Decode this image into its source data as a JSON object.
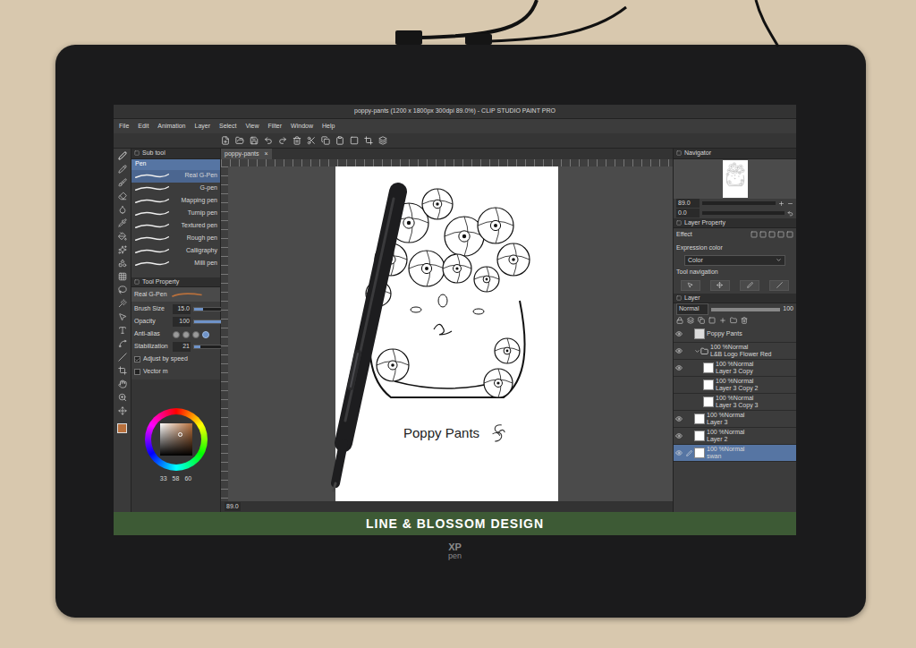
{
  "window": {
    "title": "poppy-pants (1200 x 1800px 300dpi 89.0%) - CLIP STUDIO PAINT PRO"
  },
  "menu": [
    "File",
    "Edit",
    "Animation",
    "Layer",
    "Select",
    "View",
    "Filter",
    "Window",
    "Help"
  ],
  "sub_tool": {
    "title": "Sub tool",
    "groups": [
      {
        "label": "Pen",
        "selected": true
      }
    ],
    "items": [
      {
        "label": "Real G-Pen",
        "selected": true
      },
      {
        "label": "G-pen",
        "selected": false
      },
      {
        "label": "Mapping pen",
        "selected": false
      },
      {
        "label": "Turnip pen",
        "selected": false
      },
      {
        "label": "Textured pen",
        "selected": false
      },
      {
        "label": "Rough pen",
        "selected": false
      },
      {
        "label": "Calligraphy",
        "selected": false
      },
      {
        "label": "Milli pen",
        "selected": false
      }
    ]
  },
  "tool_property": {
    "title": "Tool Property",
    "preset": "Real G-Pen",
    "rows": [
      {
        "kind": "slider",
        "label": "Brush Size",
        "value": "15.0",
        "level": 0.3
      },
      {
        "kind": "slider",
        "label": "Opacity",
        "value": "100",
        "level": 1
      },
      {
        "kind": "choice",
        "label": "Anti-alias",
        "options": [
          {
            "selected": false
          },
          {
            "selected": false
          },
          {
            "selected": false
          },
          {
            "selected": true
          }
        ]
      },
      {
        "kind": "slider",
        "label": "Stabilization",
        "value": "21",
        "level": 0.21
      },
      {
        "kind": "checkbox",
        "label": "Adjust by speed",
        "checked": true
      },
      {
        "kind": "checkbox",
        "label": "Vector m",
        "checked": false
      }
    ]
  },
  "color": {
    "main": "#b8703c",
    "values": [
      "33",
      "58",
      "60"
    ]
  },
  "document_tab": {
    "label": "poppy-pants",
    "close": "×"
  },
  "canvas": {
    "zoom": "89.0",
    "artwork_text": "Poppy Pants"
  },
  "navigator": {
    "title": "Navigator",
    "zoom": "89.0",
    "rotation": "0.0"
  },
  "layer_property": {
    "title": "Layer Property",
    "effect": "Effect",
    "expression_label": "Expression color",
    "expression_value": "Color",
    "tool_navigation": "Tool navigation"
  },
  "layers_panel": {
    "title": "Layer",
    "blend": "Normal",
    "opacity": "100",
    "layers": [
      {
        "name": "Poppy Pants",
        "kind": "text",
        "visible": true,
        "in_folder": false,
        "selected": false
      },
      {
        "name": "L&B Logo Flower Red",
        "mode": "100 %Normal",
        "kind": "folder",
        "expanded": true,
        "visible": true,
        "in_folder": false,
        "selected": false
      },
      {
        "name": "Layer 3 Copy",
        "mode": "100 %Normal",
        "kind": "raster",
        "visible": true,
        "in_folder": true,
        "selected": false
      },
      {
        "name": "Layer 3 Copy 2",
        "mode": "100 %Normal",
        "kind": "raster",
        "visible": false,
        "in_folder": true,
        "selected": false
      },
      {
        "name": "Layer 3 Copy 3",
        "mode": "100 %Normal",
        "kind": "raster",
        "visible": false,
        "in_folder": true,
        "selected": false
      },
      {
        "name": "Layer 3",
        "mode": "100 %Normal",
        "kind": "raster",
        "visible": true,
        "in_folder": false,
        "selected": false
      },
      {
        "name": "Layer 2",
        "mode": "100 %Normal",
        "kind": "raster",
        "visible": true,
        "in_folder": false,
        "selected": false
      },
      {
        "name": "swan",
        "mode": "100 %Normal",
        "kind": "raster",
        "visible": true,
        "in_folder": false,
        "selected": true
      }
    ]
  },
  "banner": "LINE & BLOSSOM DESIGN",
  "device_logo": [
    "XP",
    "pen"
  ]
}
